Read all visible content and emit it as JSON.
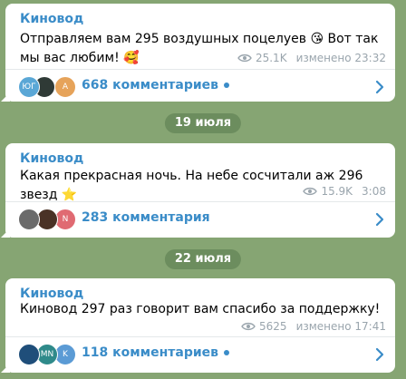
{
  "channel": "Киновод",
  "posts": [
    {
      "author": "Киновод",
      "text": "Отправляем вам 295 воздушных поцелуев 😘 Вот так мы вас любим! 🥰",
      "views": "25.1K",
      "time": "изменено 23:32",
      "comments": "668 комментариев",
      "avatars": [
        "ЮГ",
        "",
        "А"
      ]
    },
    {
      "author": "Киновод",
      "text": "Какая прекрасная ночь. На небе сосчитали аж 296 звезд ⭐",
      "views": "15.9K",
      "time": "3:08",
      "comments": "283 комментария",
      "avatars": [
        "",
        "",
        "N"
      ]
    },
    {
      "author": "Киновод",
      "text": "Киновод 297 раз говорит вам спасибо за поддержку!",
      "views": "5625",
      "time": "изменено 17:41",
      "comments": "118 комментариев",
      "avatars": [
        "",
        "MN",
        "K"
      ]
    }
  ],
  "dates": [
    "19 июля",
    "22 июля"
  ],
  "colors": {
    "background": "#86a573",
    "accent": "#3a8cc8",
    "date_chip": "#6c8d5e"
  },
  "icons": [
    "eye-icon",
    "chevron-right-icon"
  ]
}
